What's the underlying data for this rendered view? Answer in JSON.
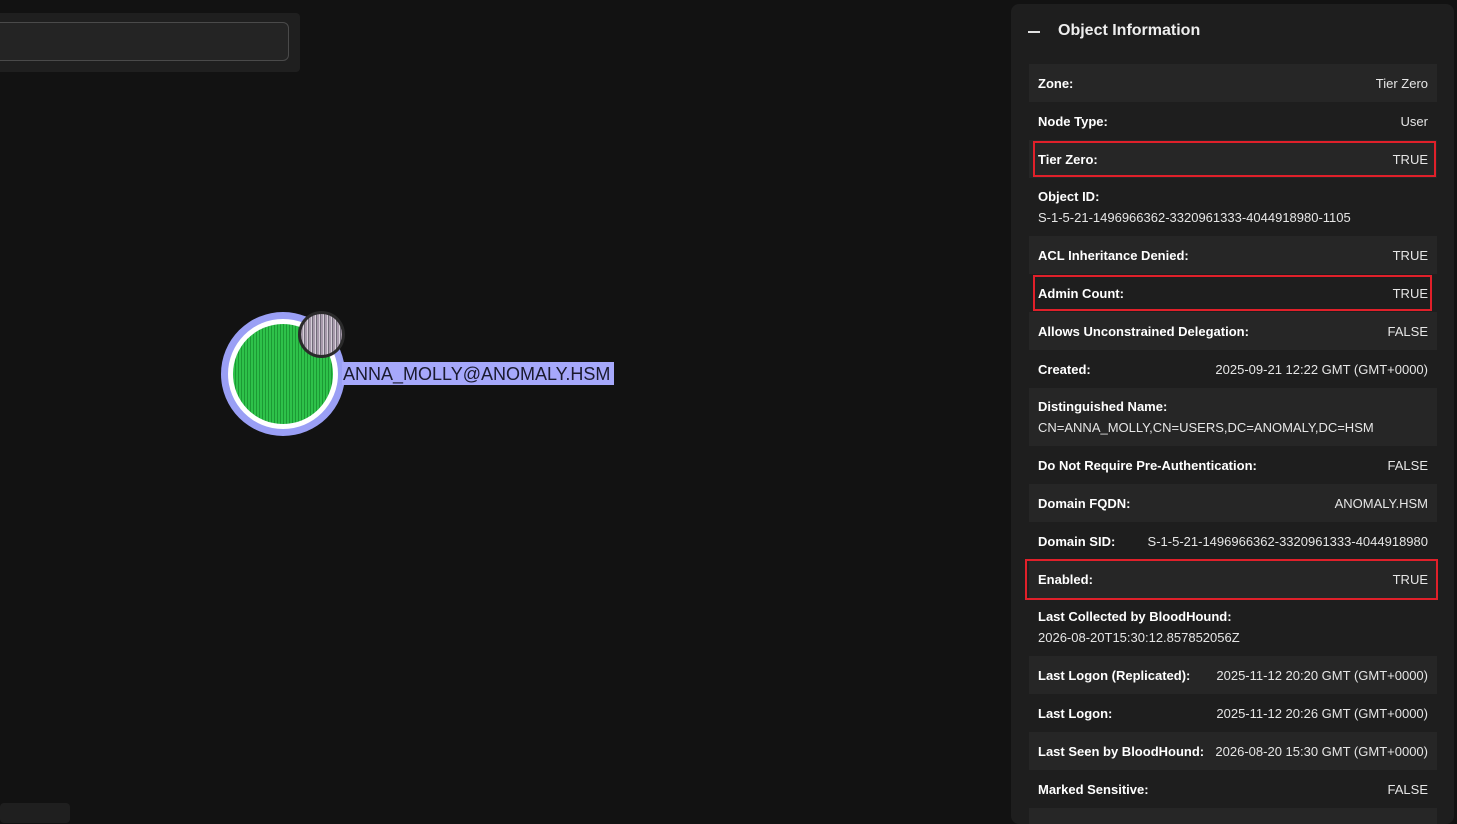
{
  "search": {
    "value": "",
    "placeholder": ""
  },
  "graph": {
    "node_label": "ANNA_MOLLY@ANOMALY.HSM",
    "node_icon": "user-node-icon",
    "badge_icon": "tier-zero-badge-icon"
  },
  "panel": {
    "title": "Object Information",
    "collapse_icon": "minus-icon",
    "highlight_color": "#e0202a",
    "properties": [
      {
        "key": "Zone:",
        "value": "Tier Zero"
      },
      {
        "key": "Node Type:",
        "value": "User"
      },
      {
        "key": "Tier Zero:",
        "value": "TRUE",
        "highlighted": true
      },
      {
        "key": "Object ID:",
        "value": "S-1-5-21-1496966362-3320961333-4044918980-1105"
      },
      {
        "key": "ACL Inheritance Denied:",
        "value": "TRUE"
      },
      {
        "key": "Admin Count:",
        "value": "TRUE",
        "highlighted": true
      },
      {
        "key": "Allows Unconstrained Delegation:",
        "value": "FALSE"
      },
      {
        "key": "Created:",
        "value": "2025-09-21 12:22 GMT (GMT+0000)"
      },
      {
        "key": "Distinguished Name:",
        "value": "CN=ANNA_MOLLY,CN=USERS,DC=ANOMALY,DC=HSM"
      },
      {
        "key": "Do Not Require Pre-Authentication:",
        "value": "FALSE"
      },
      {
        "key": "Domain FQDN:",
        "value": "ANOMALY.HSM"
      },
      {
        "key": "Domain SID:",
        "value": "S-1-5-21-1496966362-3320961333-4044918980"
      },
      {
        "key": "Enabled:",
        "value": "TRUE",
        "highlighted": true
      },
      {
        "key": "Last Collected by BloodHound:",
        "value": "2026-08-20T15:30:12.857852056Z"
      },
      {
        "key": "Last Logon (Replicated):",
        "value": "2025-11-12 20:20 GMT (GMT+0000)"
      },
      {
        "key": "Last Logon:",
        "value": "2025-11-12 20:26 GMT (GMT+0000)"
      },
      {
        "key": "Last Seen by BloodHound:",
        "value": "2026-08-20 15:30 GMT (GMT+0000)"
      },
      {
        "key": "Marked Sensitive:",
        "value": "FALSE"
      }
    ]
  }
}
